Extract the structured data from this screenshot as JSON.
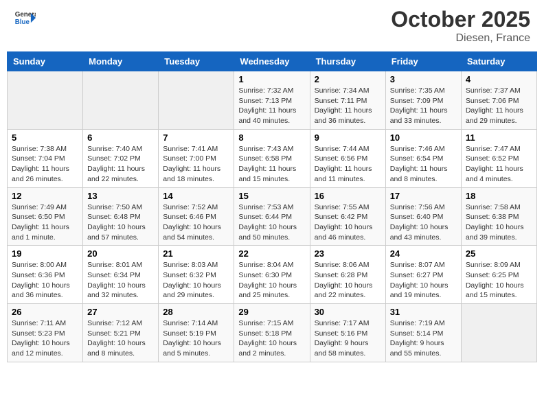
{
  "header": {
    "logo_line1": "General",
    "logo_line2": "Blue",
    "month": "October 2025",
    "location": "Diesen, France"
  },
  "weekdays": [
    "Sunday",
    "Monday",
    "Tuesday",
    "Wednesday",
    "Thursday",
    "Friday",
    "Saturday"
  ],
  "weeks": [
    [
      {
        "day": "",
        "info": ""
      },
      {
        "day": "",
        "info": ""
      },
      {
        "day": "",
        "info": ""
      },
      {
        "day": "1",
        "info": "Sunrise: 7:32 AM\nSunset: 7:13 PM\nDaylight: 11 hours and 40 minutes."
      },
      {
        "day": "2",
        "info": "Sunrise: 7:34 AM\nSunset: 7:11 PM\nDaylight: 11 hours and 36 minutes."
      },
      {
        "day": "3",
        "info": "Sunrise: 7:35 AM\nSunset: 7:09 PM\nDaylight: 11 hours and 33 minutes."
      },
      {
        "day": "4",
        "info": "Sunrise: 7:37 AM\nSunset: 7:06 PM\nDaylight: 11 hours and 29 minutes."
      }
    ],
    [
      {
        "day": "5",
        "info": "Sunrise: 7:38 AM\nSunset: 7:04 PM\nDaylight: 11 hours and 26 minutes."
      },
      {
        "day": "6",
        "info": "Sunrise: 7:40 AM\nSunset: 7:02 PM\nDaylight: 11 hours and 22 minutes."
      },
      {
        "day": "7",
        "info": "Sunrise: 7:41 AM\nSunset: 7:00 PM\nDaylight: 11 hours and 18 minutes."
      },
      {
        "day": "8",
        "info": "Sunrise: 7:43 AM\nSunset: 6:58 PM\nDaylight: 11 hours and 15 minutes."
      },
      {
        "day": "9",
        "info": "Sunrise: 7:44 AM\nSunset: 6:56 PM\nDaylight: 11 hours and 11 minutes."
      },
      {
        "day": "10",
        "info": "Sunrise: 7:46 AM\nSunset: 6:54 PM\nDaylight: 11 hours and 8 minutes."
      },
      {
        "day": "11",
        "info": "Sunrise: 7:47 AM\nSunset: 6:52 PM\nDaylight: 11 hours and 4 minutes."
      }
    ],
    [
      {
        "day": "12",
        "info": "Sunrise: 7:49 AM\nSunset: 6:50 PM\nDaylight: 11 hours and 1 minute."
      },
      {
        "day": "13",
        "info": "Sunrise: 7:50 AM\nSunset: 6:48 PM\nDaylight: 10 hours and 57 minutes."
      },
      {
        "day": "14",
        "info": "Sunrise: 7:52 AM\nSunset: 6:46 PM\nDaylight: 10 hours and 54 minutes."
      },
      {
        "day": "15",
        "info": "Sunrise: 7:53 AM\nSunset: 6:44 PM\nDaylight: 10 hours and 50 minutes."
      },
      {
        "day": "16",
        "info": "Sunrise: 7:55 AM\nSunset: 6:42 PM\nDaylight: 10 hours and 46 minutes."
      },
      {
        "day": "17",
        "info": "Sunrise: 7:56 AM\nSunset: 6:40 PM\nDaylight: 10 hours and 43 minutes."
      },
      {
        "day": "18",
        "info": "Sunrise: 7:58 AM\nSunset: 6:38 PM\nDaylight: 10 hours and 39 minutes."
      }
    ],
    [
      {
        "day": "19",
        "info": "Sunrise: 8:00 AM\nSunset: 6:36 PM\nDaylight: 10 hours and 36 minutes."
      },
      {
        "day": "20",
        "info": "Sunrise: 8:01 AM\nSunset: 6:34 PM\nDaylight: 10 hours and 32 minutes."
      },
      {
        "day": "21",
        "info": "Sunrise: 8:03 AM\nSunset: 6:32 PM\nDaylight: 10 hours and 29 minutes."
      },
      {
        "day": "22",
        "info": "Sunrise: 8:04 AM\nSunset: 6:30 PM\nDaylight: 10 hours and 25 minutes."
      },
      {
        "day": "23",
        "info": "Sunrise: 8:06 AM\nSunset: 6:28 PM\nDaylight: 10 hours and 22 minutes."
      },
      {
        "day": "24",
        "info": "Sunrise: 8:07 AM\nSunset: 6:27 PM\nDaylight: 10 hours and 19 minutes."
      },
      {
        "day": "25",
        "info": "Sunrise: 8:09 AM\nSunset: 6:25 PM\nDaylight: 10 hours and 15 minutes."
      }
    ],
    [
      {
        "day": "26",
        "info": "Sunrise: 7:11 AM\nSunset: 5:23 PM\nDaylight: 10 hours and 12 minutes."
      },
      {
        "day": "27",
        "info": "Sunrise: 7:12 AM\nSunset: 5:21 PM\nDaylight: 10 hours and 8 minutes."
      },
      {
        "day": "28",
        "info": "Sunrise: 7:14 AM\nSunset: 5:19 PM\nDaylight: 10 hours and 5 minutes."
      },
      {
        "day": "29",
        "info": "Sunrise: 7:15 AM\nSunset: 5:18 PM\nDaylight: 10 hours and 2 minutes."
      },
      {
        "day": "30",
        "info": "Sunrise: 7:17 AM\nSunset: 5:16 PM\nDaylight: 9 hours and 58 minutes."
      },
      {
        "day": "31",
        "info": "Sunrise: 7:19 AM\nSunset: 5:14 PM\nDaylight: 9 hours and 55 minutes."
      },
      {
        "day": "",
        "info": ""
      }
    ]
  ]
}
